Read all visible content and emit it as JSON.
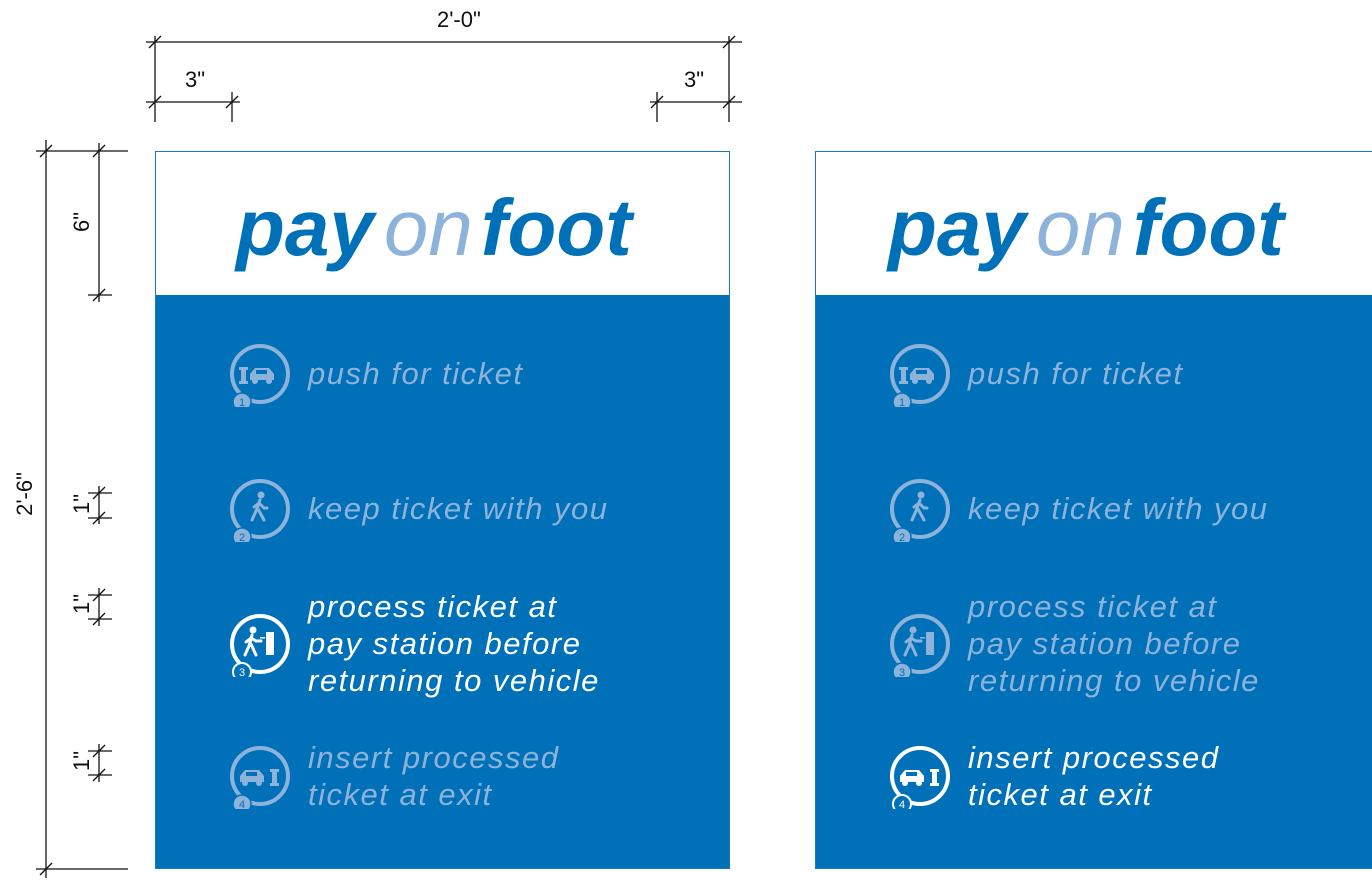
{
  "dimensions": {
    "overall_width": "2'-0\"",
    "margin_left": "3\"",
    "margin_right": "3\"",
    "overall_height": "2'-6\"",
    "header_height": "6\"",
    "gap_1": "1\"",
    "gap_2": "1\"",
    "gap_3": "1\""
  },
  "colors": {
    "sign_blue": "#0071b8",
    "muted_text": "#8eb3db",
    "highlight_text": "#ffffff"
  },
  "signs": [
    {
      "brand": {
        "pay": "pay",
        "on": "on",
        "foot": "foot"
      },
      "active_step": 3,
      "steps": [
        {
          "number": "1",
          "icon": "gate-car-icon",
          "lines": [
            "push for ticket"
          ]
        },
        {
          "number": "2",
          "icon": "walking-person-icon",
          "lines": [
            "keep ticket with you"
          ]
        },
        {
          "number": "3",
          "icon": "person-pay-station-icon",
          "lines": [
            "process ticket at",
            "pay station before",
            "returning to vehicle"
          ]
        },
        {
          "number": "4",
          "icon": "car-gate-exit-icon",
          "lines": [
            "insert processed",
            "ticket at exit"
          ]
        }
      ]
    },
    {
      "brand": {
        "pay": "pay",
        "on": "on",
        "foot": "foot"
      },
      "active_step": 4,
      "steps": [
        {
          "number": "1",
          "icon": "gate-car-icon",
          "lines": [
            "push for ticket"
          ]
        },
        {
          "number": "2",
          "icon": "walking-person-icon",
          "lines": [
            "keep ticket with you"
          ]
        },
        {
          "number": "3",
          "icon": "person-pay-station-icon",
          "lines": [
            "process ticket at",
            "pay station before",
            "returning to vehicle"
          ]
        },
        {
          "number": "4",
          "icon": "car-gate-exit-icon",
          "lines": [
            "insert processed",
            "ticket at exit"
          ]
        }
      ]
    }
  ]
}
